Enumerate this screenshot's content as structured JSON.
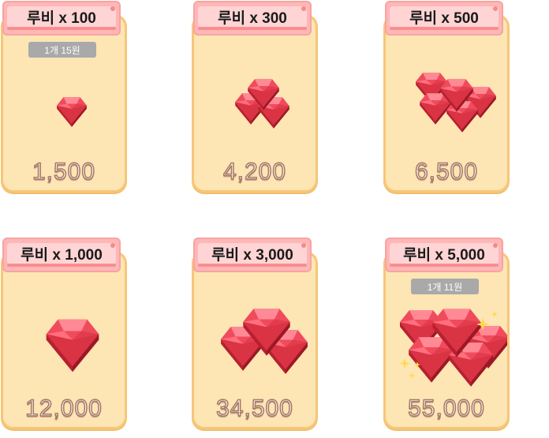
{
  "products": [
    {
      "title": "루비 x 100",
      "badge": "1개 15원",
      "price": "1,500",
      "icon": "ruby-single-icon"
    },
    {
      "title": "루비 x 300",
      "badge": "",
      "price": "4,200",
      "icon": "ruby-three-icon"
    },
    {
      "title": "루비 x 500",
      "badge": "",
      "price": "6,500",
      "icon": "ruby-pile-icon"
    },
    {
      "title": "루비 x 1,000",
      "badge": "",
      "price": "12,000",
      "icon": "ruby-large-icon"
    },
    {
      "title": "루비 x 3,000",
      "badge": "",
      "price": "34,500",
      "icon": "ruby-large-three-icon"
    },
    {
      "title": "루비 x 5,000",
      "badge": "1개 11원",
      "price": "55,000",
      "icon": "ruby-sparkle-pile-icon"
    }
  ],
  "colors": {
    "card_bg": "#fde5b4",
    "card_border": "#f6c777",
    "banner": "#ffb6b6",
    "ruby": "#f04b5c",
    "badge": "#a9a9a9"
  }
}
